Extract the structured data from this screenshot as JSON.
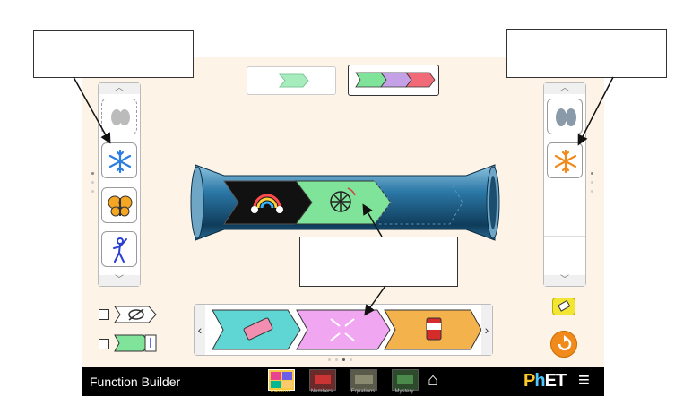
{
  "app": {
    "title": "Function Builder"
  },
  "screens": [
    {
      "name": "Patterns",
      "selected": true
    },
    {
      "name": "Numbers",
      "selected": false
    },
    {
      "name": "Equations",
      "selected": false
    },
    {
      "name": "Mystery",
      "selected": false
    }
  ],
  "brand": {
    "logo": "PhET"
  },
  "icons": {
    "input_cards": [
      "feet-icon",
      "snowflake-icon",
      "butterfly-icon",
      "stick-figure-icon"
    ],
    "output_cards": [
      "feet-icon",
      "snowflake-icon"
    ],
    "builder_functions": [
      "rainbow-icon",
      "ferris-wheel-icon"
    ],
    "function_carousel": [
      "eraser-icon",
      "shrink-icon",
      "paint-can-icon"
    ],
    "controls": [
      "eraser-button-icon",
      "reset-all-icon",
      "eye-off-icon",
      "function-icon"
    ]
  },
  "colors": {
    "background": "#fdf3e6",
    "function_cyan": "#5fd6d3",
    "function_pink": "#f0a6f0",
    "function_orange": "#f3b24c",
    "function_green": "#7fe39a",
    "function_purple": "#c4a0e6",
    "function_red": "#f06a78",
    "builder_blue": "#1f5f86",
    "reset_orange": "#f08a1b"
  },
  "function_carousel": {
    "page_index": 3,
    "page_count": 4
  }
}
